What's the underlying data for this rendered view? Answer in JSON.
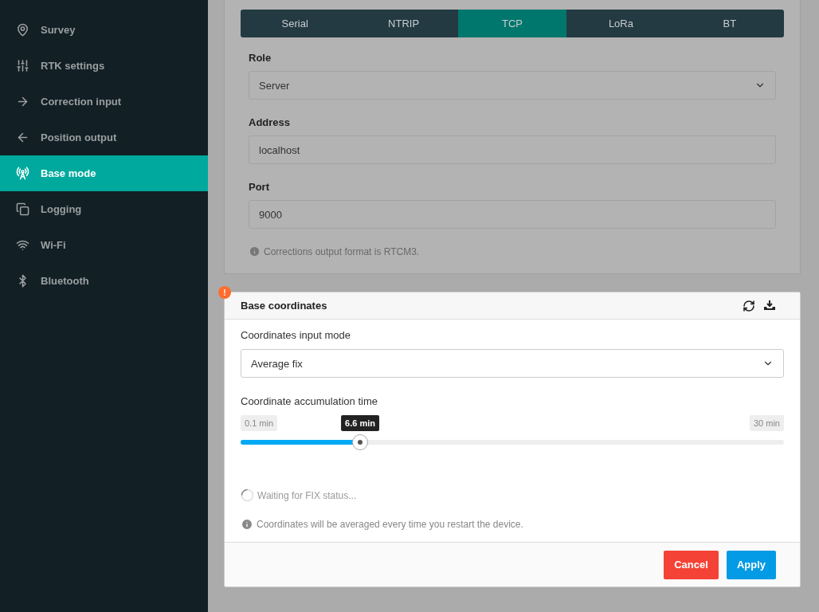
{
  "sidebar": {
    "items": [
      {
        "label": "Survey",
        "selected": false
      },
      {
        "label": "RTK settings",
        "selected": false
      },
      {
        "label": "Correction input",
        "selected": false
      },
      {
        "label": "Position output",
        "selected": false
      },
      {
        "label": "Base mode",
        "selected": true
      },
      {
        "label": "Logging",
        "selected": false
      },
      {
        "label": "Wi-Fi",
        "selected": false
      },
      {
        "label": "Bluetooth",
        "selected": false
      }
    ]
  },
  "output_card": {
    "tabs": [
      {
        "label": "Serial",
        "selected": false
      },
      {
        "label": "NTRIP",
        "selected": false
      },
      {
        "label": "TCP",
        "selected": true
      },
      {
        "label": "LoRa",
        "selected": false
      },
      {
        "label": "BT",
        "selected": false
      }
    ],
    "fields": [
      {
        "label": "Role",
        "kind": "select",
        "value": "Server"
      },
      {
        "label": "Address",
        "kind": "text",
        "value": "localhost"
      },
      {
        "label": "Port",
        "kind": "text",
        "value": "9000"
      }
    ],
    "note": "Corrections output format is RTCM3."
  },
  "base_card": {
    "title": "Base coordinates",
    "warning": "!",
    "input_mode": {
      "label": "Coordinates input mode",
      "value": "Average fix"
    },
    "slider": {
      "label": "Coordinate accumulation time",
      "min": "0.1 min",
      "max": "30 min",
      "reading": "6.6 min",
      "level": 0.22
    },
    "status": "Waiting for FIX status...",
    "note": "Coordinates will be averaged every time you restart the device.",
    "buttons": [
      {
        "label": "Cancel",
        "kind": "cancel"
      },
      {
        "label": "Apply",
        "kind": "apply"
      }
    ]
  }
}
